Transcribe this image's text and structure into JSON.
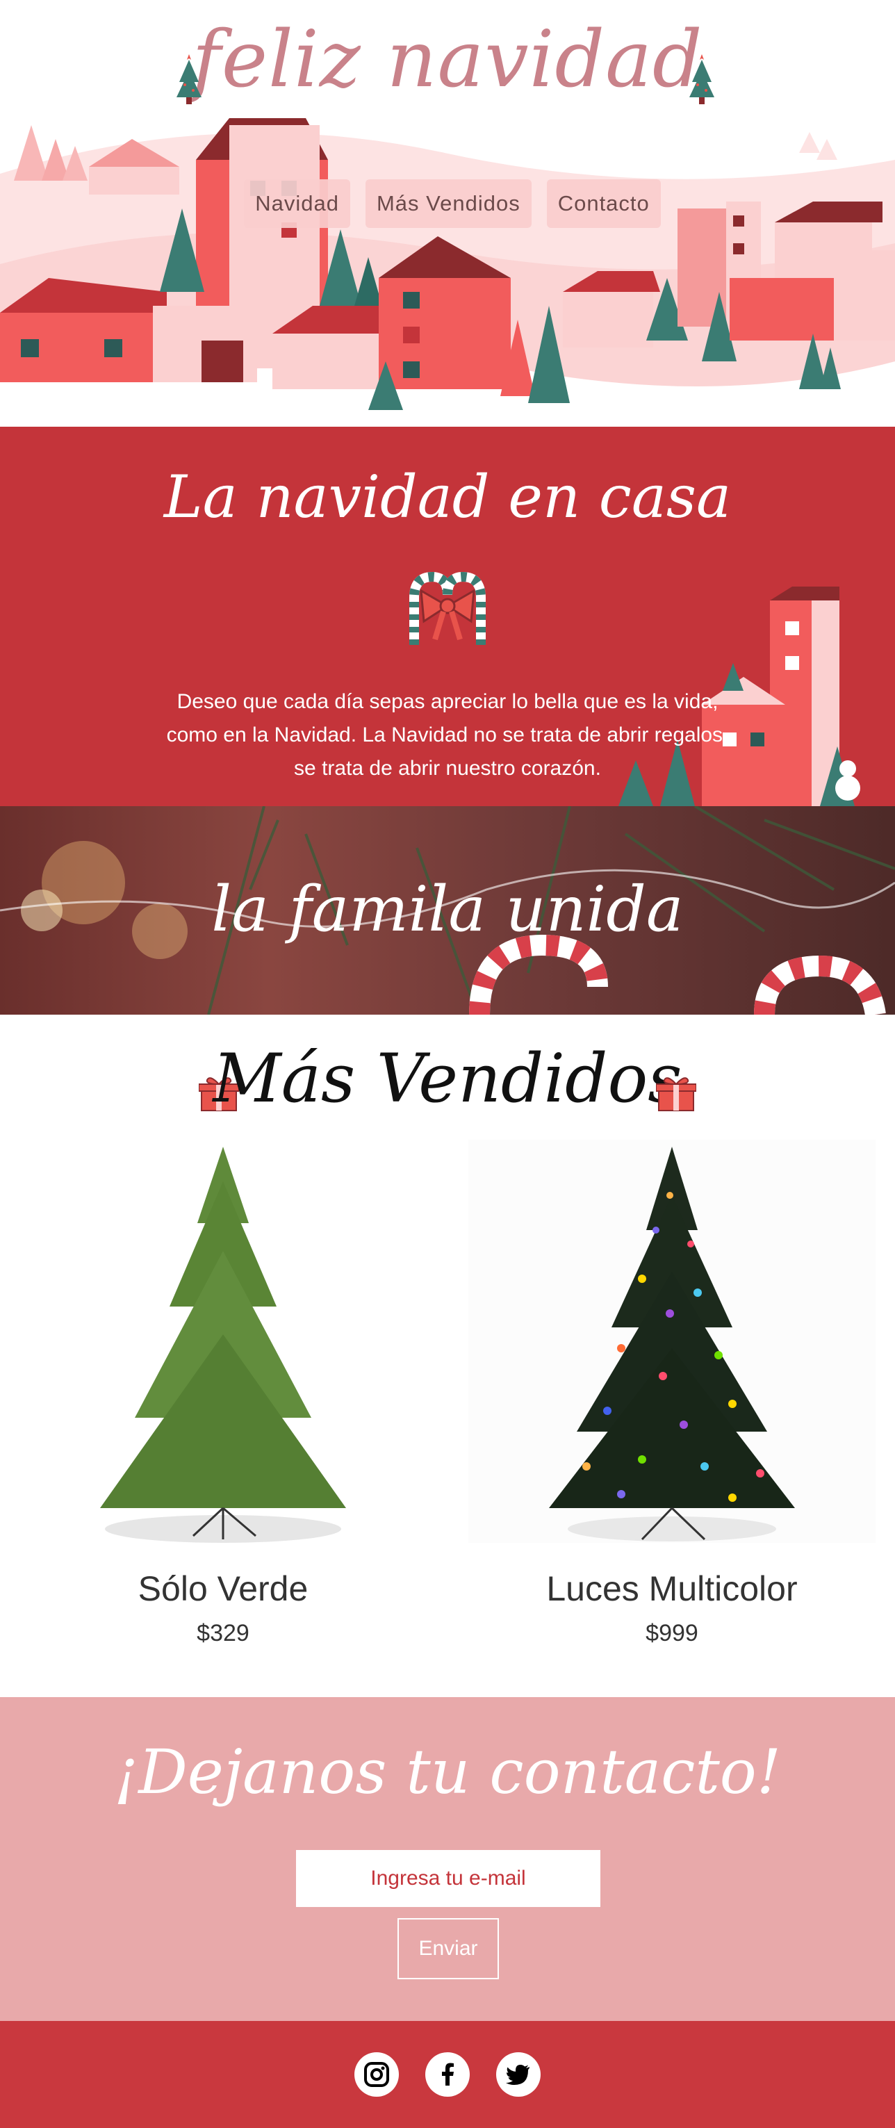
{
  "header": {
    "brand": "feliz navidad",
    "nav": [
      {
        "label": "Navidad"
      },
      {
        "label": "Más Vendidos"
      },
      {
        "label": "Contacto"
      }
    ]
  },
  "casa": {
    "title": "La navidad en casa",
    "text": "Deseo que cada día sepas apreciar lo bella que es la vida, como en la Navidad. La Navidad no se trata de abrir regalos, se trata de abrir nuestro corazón."
  },
  "familia": {
    "title": "la famila unida"
  },
  "vendidos": {
    "title": "Más Vendidos",
    "products": [
      {
        "name": "Sólo Verde",
        "price": "$329"
      },
      {
        "name": "Luces Multicolor",
        "price": "$999"
      }
    ]
  },
  "contact": {
    "title": "¡Dejanos tu contacto!",
    "email_placeholder": "Ingresa tu e-mail",
    "send_label": "Enviar"
  },
  "footer": {
    "icons": [
      "instagram-icon",
      "facebook-icon",
      "twitter-icon"
    ]
  },
  "colors": {
    "primary_red": "#c4343a",
    "pink": "#e8a9aa",
    "brand_pink": "#c9828a",
    "tree_teal": "#3b7c73"
  }
}
